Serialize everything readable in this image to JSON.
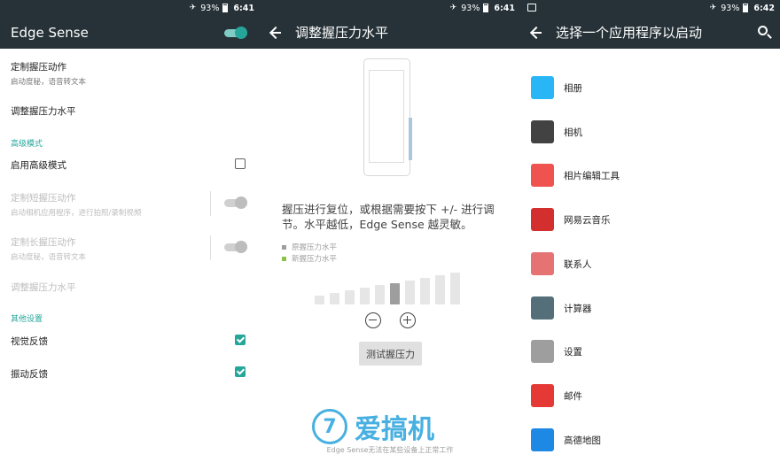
{
  "panel1": {
    "status": {
      "icons": "✈",
      "battery": "93%",
      "time": "6:41"
    },
    "title": "Edge Sense",
    "master_toggle": "on",
    "items": [
      {
        "title": "定制握压动作",
        "subtitle": "启动度秘，语音转文本"
      },
      {
        "title": "调整握压力水平",
        "subtitle": ""
      }
    ],
    "advanced": {
      "header": "高级模式",
      "enable_label": "启用高级模式",
      "enable_checked": false,
      "short_title": "定制短握压动作",
      "short_subtitle": "启动相机应用程序，进行拍照/录制视频",
      "long_title": "定制长握压动作",
      "long_subtitle": "启动度秘，语音转文本",
      "level_title": "调整握压力水平"
    },
    "other": {
      "header": "其他设置",
      "visual_label": "视觉反馈",
      "visual_checked": true,
      "vibrate_label": "振动反馈",
      "vibrate_checked": true
    }
  },
  "panel2": {
    "status": {
      "icons": "✈",
      "battery": "93%",
      "time": "6:41"
    },
    "title": "调整握压力水平",
    "description": "握压进行复位，或根据需要按下 +/- 进行调节。水平越低，Edge Sense 越灵敏。",
    "legend": [
      {
        "label": "原握压力水平",
        "color": "#9e9e9e"
      },
      {
        "label": "新握压力水平",
        "color": "#8bc34a"
      }
    ],
    "level": {
      "total": 10,
      "selected": 5
    },
    "test_button": "测试握压力",
    "footer": "Edge Sense无法在某些设备上正常工作"
  },
  "panel3": {
    "status": {
      "icons": "✈",
      "battery": "93%",
      "time": "6:42"
    },
    "title": "选择一个应用程序以启动",
    "apps": [
      {
        "name": "相册",
        "icon": "gallery-icon",
        "color": "#29b6f6"
      },
      {
        "name": "相机",
        "icon": "camera-icon",
        "color": "#424242"
      },
      {
        "name": "相片编辑工具",
        "icon": "photo-editor-icon",
        "color": "#ef5350"
      },
      {
        "name": "网易云音乐",
        "icon": "netease-music-icon",
        "color": "#d32f2f"
      },
      {
        "name": "联系人",
        "icon": "contacts-icon",
        "color": "#e57373"
      },
      {
        "name": "计算器",
        "icon": "calculator-icon",
        "color": "#546e7a"
      },
      {
        "name": "设置",
        "icon": "settings-icon",
        "color": "#9e9e9e"
      },
      {
        "name": "邮件",
        "icon": "mail-icon",
        "color": "#e53935"
      },
      {
        "name": "高德地图",
        "icon": "amap-icon",
        "color": "#1e88e5"
      }
    ]
  },
  "watermark": {
    "text": "爱搞机",
    "logo": "7"
  }
}
